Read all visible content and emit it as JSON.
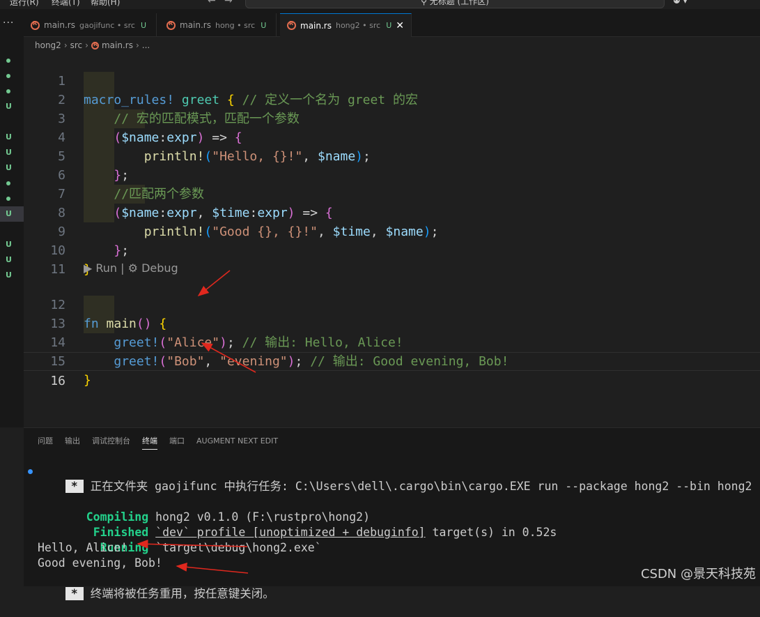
{
  "titlebar": {
    "menu_run": "运行(R)",
    "menu_terminal": "终端(T)",
    "menu_help": "帮助(H)",
    "search_text": "无标题 (工作区)",
    "back_icon": "arrow-left-icon",
    "forward_icon": "arrow-right-icon"
  },
  "activity": {
    "more": "···",
    "scm_markers": [
      "●",
      "●",
      "●",
      "U",
      "U",
      "U",
      "U",
      "●",
      "●",
      "U",
      "U",
      "U",
      "U"
    ]
  },
  "tabs": [
    {
      "name": "main.rs",
      "desc": "gaojifunc • src",
      "status": "U"
    },
    {
      "name": "main.rs",
      "desc": "hong • src",
      "status": "U"
    },
    {
      "name": "main.rs",
      "desc": "hong2 • src",
      "status": "U",
      "close": "✕"
    }
  ],
  "breadcrumb": {
    "parts": [
      "hong2",
      "src",
      "main.rs",
      "..."
    ],
    "sep": "›"
  },
  "editor": {
    "line_numbers": [
      "1",
      "2",
      "3",
      "4",
      "5",
      "6",
      "7",
      "8",
      "9",
      "10",
      "11",
      "12",
      "13",
      "14",
      "15",
      "16"
    ],
    "code": {
      "l1_macro": "macro_rules!",
      "l1_name": "greet",
      "l1_brace": "{",
      "l1_comment": "// 定义一个名为 greet 的宏",
      "l2_comment": "// 宏的匹配模式，匹配一个参数",
      "l3_open": "(",
      "l3_var": "$name",
      "l3_colon": ":",
      "l3_type": "expr",
      "l3_close": ")",
      "l3_arrow": " => ",
      "l3_brace": "{",
      "l4_fn": "println!",
      "l4_open": "(",
      "l4_str": "\"Hello, {}!\"",
      "l4_sep": ", ",
      "l4_var": "$name",
      "l4_close": ")",
      "l4_semi": ";",
      "l5_brace": "}",
      "l5_semi": ";",
      "l6_comment": "//匹配两个参数",
      "l7_open": "(",
      "l7_var1": "$name",
      "l7_colon1": ":",
      "l7_type1": "expr",
      "l7_sep": ", ",
      "l7_var2": "$time",
      "l7_colon2": ":",
      "l7_type2": "expr",
      "l7_close": ")",
      "l7_arrow": " => ",
      "l7_brace": "{",
      "l8_fn": "println!",
      "l8_open": "(",
      "l8_str": "\"Good {}, {}!\"",
      "l8_sep1": ", ",
      "l8_var1": "$time",
      "l8_sep2": ", ",
      "l8_var2": "$name",
      "l8_close": ")",
      "l8_semi": ";",
      "l9_brace": "}",
      "l9_semi": ";",
      "l10_brace": "}",
      "codelens_run": "▶ Run",
      "codelens_sep": " | ",
      "codelens_debug": "⚙ Debug",
      "l12_kw": "fn",
      "l12_name": "main",
      "l12_parens": "()",
      "l12_brace": "{",
      "l13_fn": "greet!",
      "l13_open": "(",
      "l13_str": "\"Alice\"",
      "l13_close": ")",
      "l13_semi": "; ",
      "l13_comment": "// 输出: Hello, Alice!",
      "l14_fn": "greet!",
      "l14_open": "(",
      "l14_str1": "\"Bob\"",
      "l14_sep": ", ",
      "l14_str2": "\"evening\"",
      "l14_close": ")",
      "l14_semi": "; ",
      "l14_comment": "// 输出: Good evening, Bob!",
      "l15_brace": "}"
    }
  },
  "panel": {
    "tabs": [
      "问题",
      "输出",
      "调试控制台",
      "终端",
      "端口",
      "AUGMENT NEXT EDIT"
    ],
    "active_tab": "终端",
    "terminal": {
      "badge": "*",
      "task_line": "正在文件夹 gaojifunc 中执行任务: C:\\Users\\dell\\.cargo\\bin\\cargo.EXE run --package hong2 --bin hong2",
      "compiling_kw": "Compiling",
      "compiling_rest": " hong2 v0.1.0 (F:\\rustpro\\hong2)",
      "finished_kw": "Finished",
      "finished_ul": "`dev` profile [unoptimized + debuginfo]",
      "finished_rest": " target(s) in 0.52s",
      "running_kw": "Running",
      "running_rest": " `target\\debug\\hong2.exe`",
      "out1": "Hello, Alice!",
      "out2": "Good evening, Bob!",
      "reuse_line": "终端将被任务重用，按任意键关闭。"
    }
  },
  "watermark": "CSDN @景天科技苑",
  "colors": {
    "background": "#1f1f1f",
    "annotation_arrow": "#e0281e",
    "terminal_green": "#23d18b",
    "accent": "#0078d4"
  }
}
